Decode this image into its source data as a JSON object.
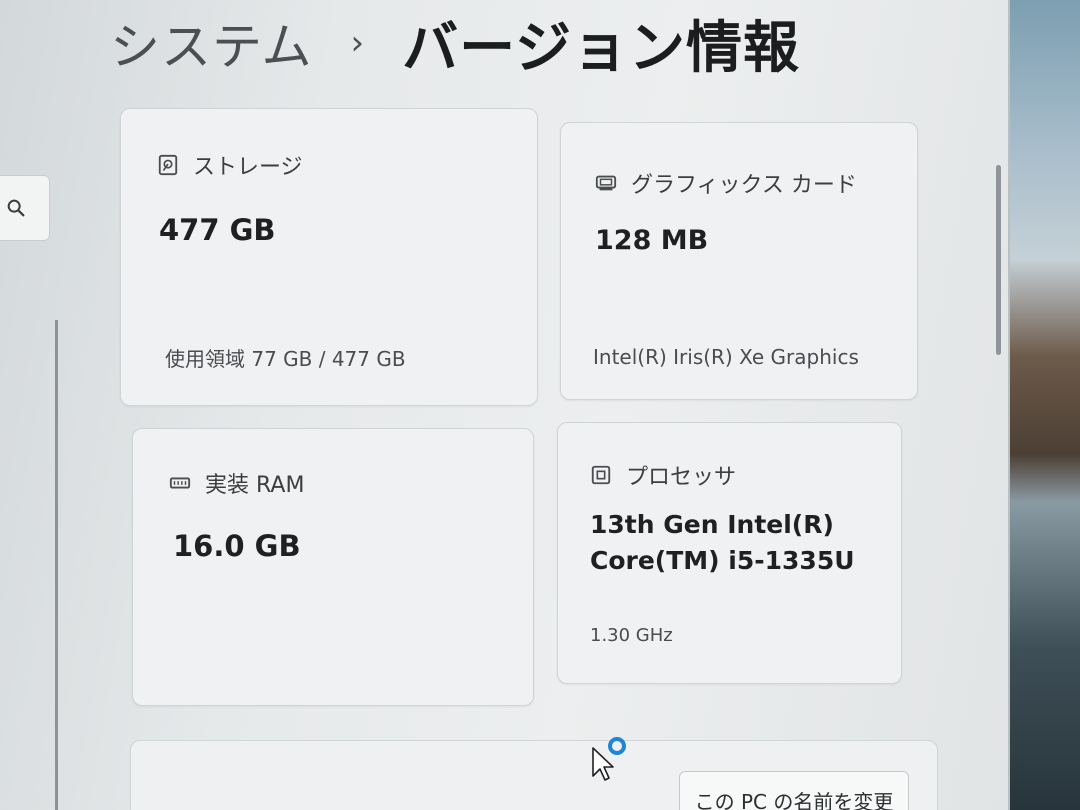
{
  "breadcrumb": {
    "parent": "システム",
    "separator": "›",
    "current": "バージョン情報"
  },
  "cards": {
    "storage": {
      "title": "ストレージ",
      "icon": "hard-drive-icon",
      "value": "477 GB",
      "sub": "使用領域 77 GB / 477 GB"
    },
    "gpu": {
      "title": "グラフィックス カード",
      "icon": "display-adapter-icon",
      "value": "128 MB",
      "sub": "Intel(R) Iris(R) Xe Graphics"
    },
    "ram": {
      "title": "実装 RAM",
      "icon": "memory-icon",
      "value": "16.0 GB"
    },
    "cpu": {
      "title": "プロセッサ",
      "icon": "processor-icon",
      "value_line1": "13th Gen Intel(R)",
      "value_line2": "Core(TM) i5-1335U",
      "sub": "1.30 GHz"
    }
  },
  "bottom": {
    "rename_button": "この PC の名前を変更"
  },
  "colors": {
    "card_background": "#f0f1f2",
    "window_background": "#e6e9ea",
    "busy_cursor_ring": "#1f86d1"
  }
}
